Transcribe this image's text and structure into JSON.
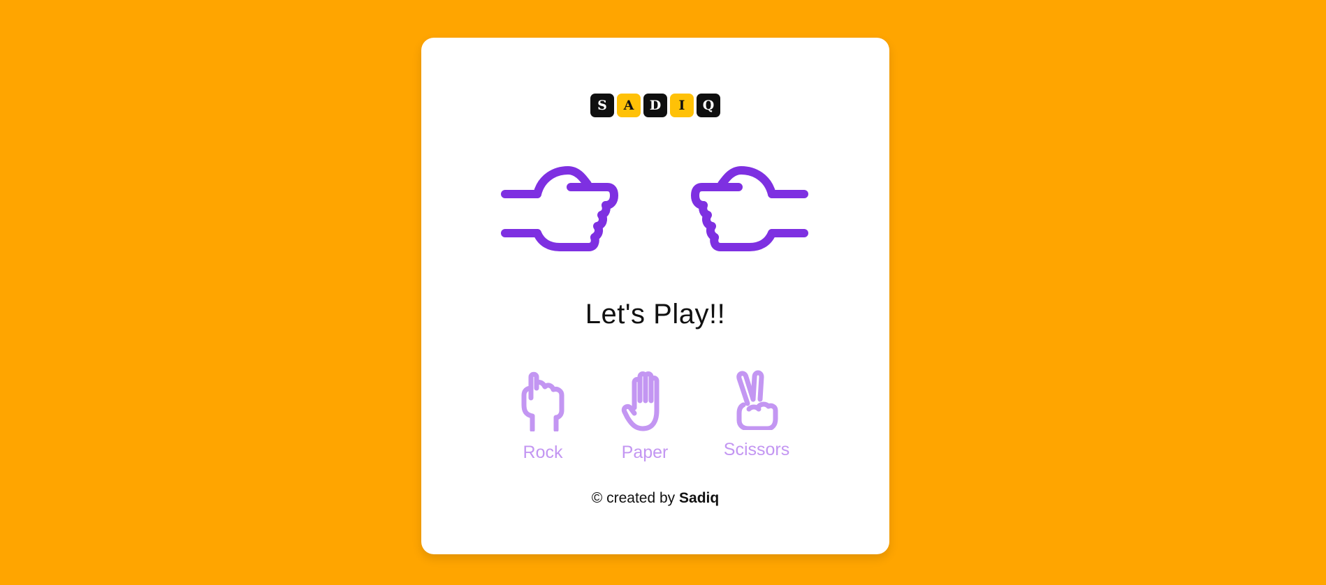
{
  "logo": {
    "letters": [
      "S",
      "A",
      "D",
      "I",
      "Q"
    ]
  },
  "title": "Let's Play!!",
  "choices": [
    {
      "label": "Rock",
      "icon": "rock-hand-icon"
    },
    {
      "label": "Paper",
      "icon": "paper-hand-icon"
    },
    {
      "label": "Scissors",
      "icon": "scissors-hand-icon"
    }
  ],
  "footer": {
    "prefix": "© created by",
    "author": "Sadiq"
  },
  "colors": {
    "background": "#FFA500",
    "accent": "#7E30E1",
    "choice": "#C396F2",
    "logo_dark": "#0f0f0f",
    "logo_gold": "#FFC107"
  }
}
